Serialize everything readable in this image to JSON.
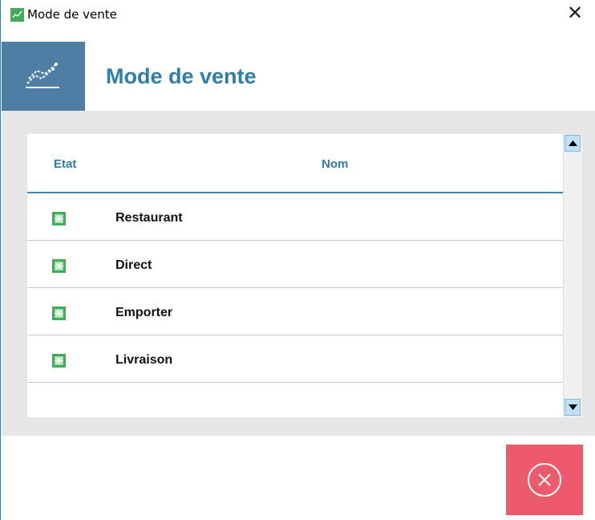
{
  "window": {
    "title": "Mode de vente",
    "close_glyph": "✕"
  },
  "header": {
    "title": "Mode de vente",
    "icon": "chart-line-icon",
    "icon_bg": "#4e7ea3"
  },
  "table": {
    "columns": {
      "etat": "Etat",
      "nom": "Nom"
    },
    "rows": [
      {
        "name": "Restaurant",
        "state_icon": "active-status-icon"
      },
      {
        "name": "Direct",
        "state_icon": "active-status-icon"
      },
      {
        "name": "Emporter",
        "state_icon": "active-status-icon"
      },
      {
        "name": "Livraison",
        "state_icon": "active-status-icon"
      }
    ]
  },
  "actions": {
    "cancel_icon": "cancel-circle-icon",
    "cancel_color": "#ed5a6d"
  },
  "colors": {
    "accent": "#2e7fa6",
    "status_green": "#3fae5a"
  }
}
